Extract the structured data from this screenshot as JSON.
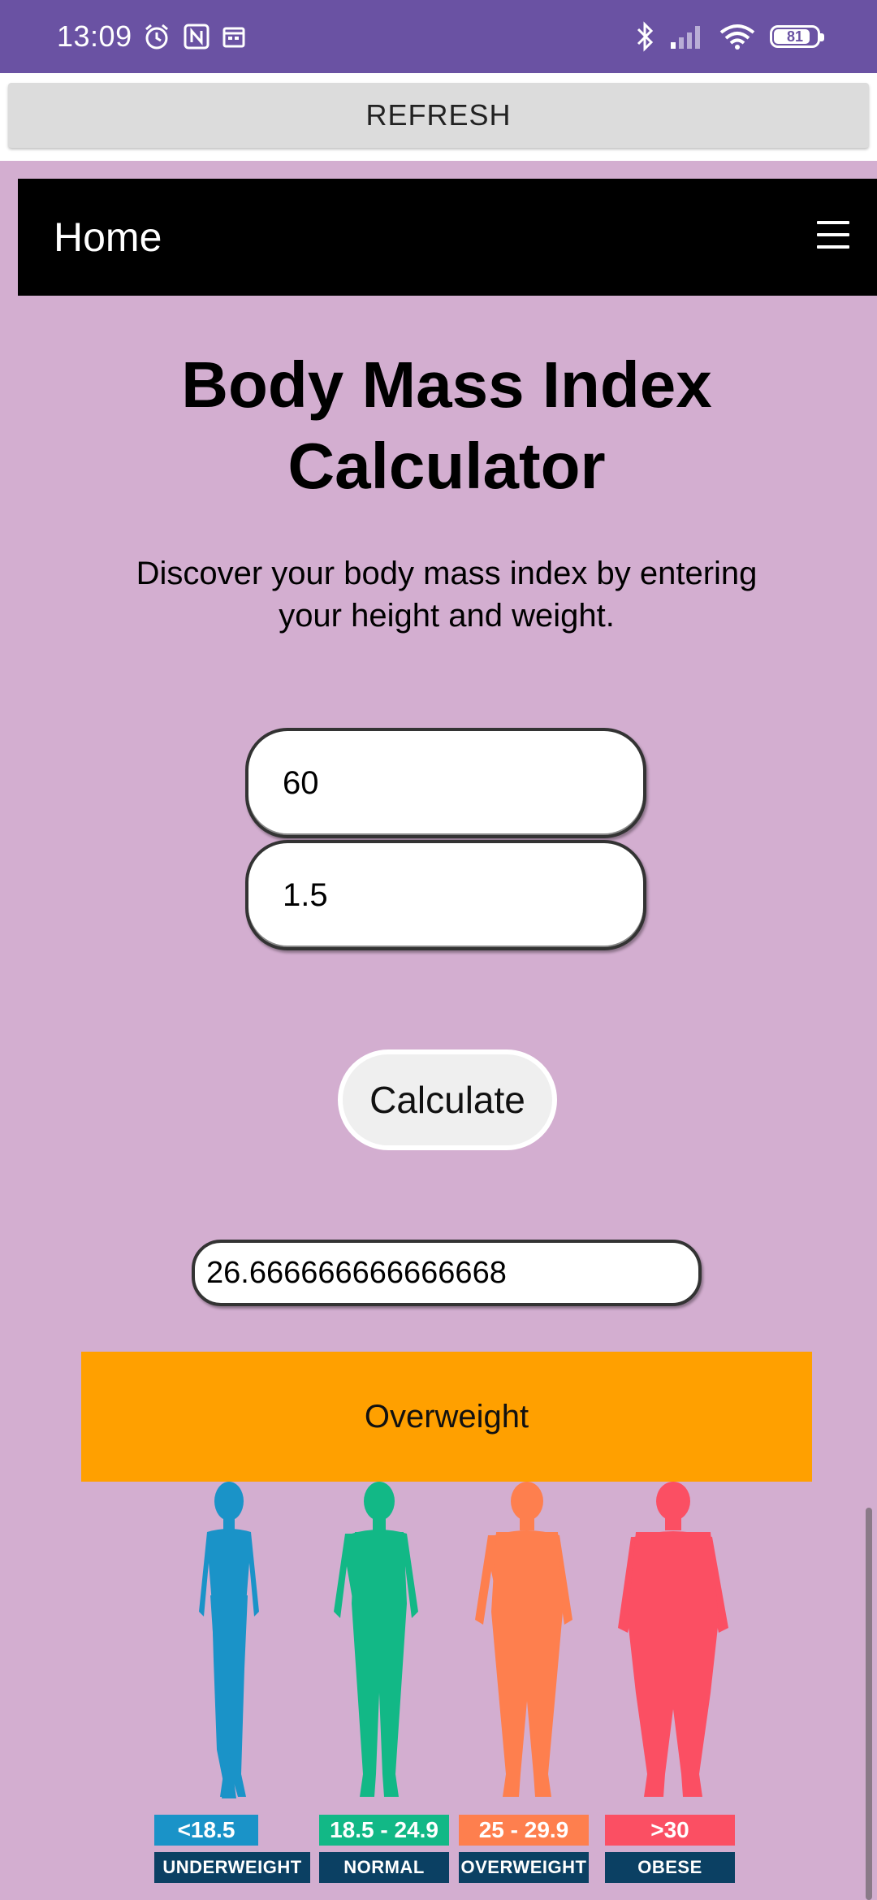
{
  "status_bar": {
    "time": "13:09",
    "battery_percent": "81",
    "icons": [
      "alarm-icon",
      "nfc-icon",
      "calendar-icon",
      "bluetooth-icon",
      "signal-icon",
      "wifi-icon",
      "battery-icon"
    ]
  },
  "refresh": {
    "label": "REFRESH"
  },
  "navbar": {
    "home_label": "Home",
    "menu_icon": "hamburger-icon"
  },
  "calculator": {
    "title_line1": "Body Mass Index",
    "title_line2": "Calculator",
    "subtitle_line1": "Discover your body mass index by entering",
    "subtitle_line2": "your height and weight.",
    "weight_value": "60",
    "height_value": "1.5",
    "calculate_label": "Calculate",
    "result_value": "26.666666666666668",
    "category_label": "Overweight",
    "category_color": "#ffa000"
  },
  "bmi_chart": {
    "categories": [
      {
        "range": "<18.5",
        "label": "UNDERWEIGHT",
        "color": "#1a93c8"
      },
      {
        "range": "18.5 - 24.9",
        "label": "NORMAL",
        "color": "#12b886"
      },
      {
        "range": "25 - 29.9",
        "label": "OVERWEIGHT",
        "color": "#fe7f4e"
      },
      {
        "range": ">30",
        "label": "OBESE",
        "color": "#fb4f63"
      }
    ],
    "label_bg_color": "#0b4063"
  }
}
